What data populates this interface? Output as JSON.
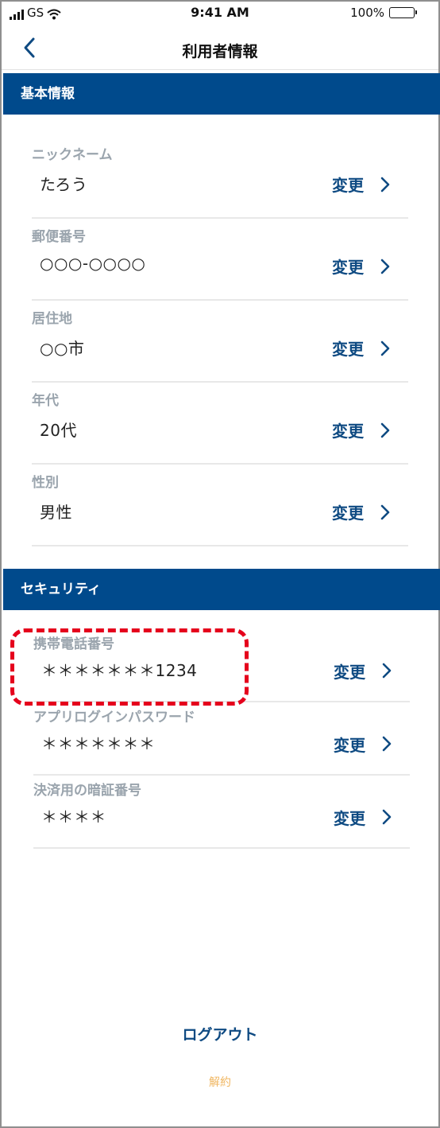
{
  "status_bar": {
    "carrier": "GS",
    "time": "9:41 AM",
    "battery": "100%"
  },
  "nav": {
    "title": "利用者情報"
  },
  "basic_section": {
    "header": "基本情報",
    "items": [
      {
        "label": "ニックネーム",
        "value": "たろう",
        "action": "変更"
      },
      {
        "label": "郵便番号",
        "value": "○○○-○○○○",
        "action": "変更"
      },
      {
        "label": "居住地",
        "value": "○○市",
        "action": "変更"
      },
      {
        "label": "年代",
        "value": "20代",
        "action": "変更"
      },
      {
        "label": "性別",
        "value": "男性",
        "action": "変更"
      }
    ]
  },
  "security_section": {
    "header": "セキュリティ",
    "items": [
      {
        "label": "携帯電話番号",
        "value": "＊＊＊＊＊＊＊1234",
        "action": "変更"
      },
      {
        "label": "アプリログインパスワード",
        "value": "＊＊＊＊＊＊＊",
        "action": "変更"
      },
      {
        "label": "決済用の暗証番号",
        "value": "＊＊＊＊",
        "action": "変更"
      }
    ]
  },
  "footer": {
    "logout": "ログアウト",
    "cancel": "解約"
  },
  "colors": {
    "header_bg": "#004a8c",
    "action": "#0e4a82",
    "label": "#9aa4ad",
    "highlight": "#e5001c",
    "cancel": "#f0b660"
  }
}
